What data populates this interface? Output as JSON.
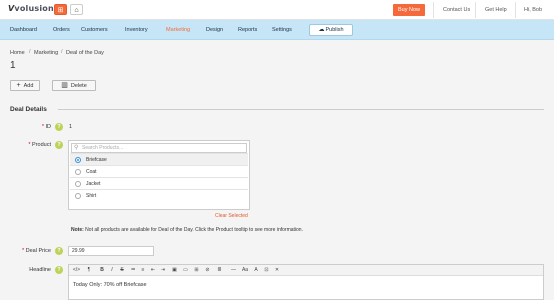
{
  "brand": {
    "logo_text": "volusion",
    "logo_mark": "V"
  },
  "topbar": {
    "store_icon": "store-icon",
    "home_icon": "home-icon",
    "buy_now": "Buy Now",
    "contact_us": "Contact Us",
    "get_help": "Get Help",
    "user": "Hi, Bob"
  },
  "nav": {
    "items": [
      "Dashboard",
      "Orders",
      "Customers",
      "Inventory",
      "Marketing",
      "Design",
      "Reports",
      "Settings"
    ],
    "active": "Marketing",
    "publish": "Publish"
  },
  "breadcrumb": [
    "Home",
    "Marketing",
    "Deal of the Day"
  ],
  "page_title": "1",
  "actions": {
    "add": "Add",
    "delete": "Delete"
  },
  "section": {
    "title": "Deal Details"
  },
  "fields": {
    "id_label": "ID",
    "id_value": "1",
    "product_label": "Product",
    "search_placeholder": "Search Products...",
    "products": [
      {
        "name": "Briefcase",
        "selected": true
      },
      {
        "name": "Coat",
        "selected": false
      },
      {
        "name": "Jacket",
        "selected": false
      },
      {
        "name": "Shirt",
        "selected": false
      }
    ],
    "clear_selected": "Clear Selected",
    "note_label": "Note:",
    "note_text": "Not all products are available for Deal of the Day. Click the Product tooltip to see more information.",
    "price_label": "Deal Price",
    "price_value": "29.99",
    "headline_label": "Headline",
    "headline_text": "Today Only: 70% off Briefcase"
  },
  "editor_toolbar": [
    "</>",
    "¶",
    "B",
    "I",
    "S",
    "≔",
    "≡",
    "⇤",
    "⇥",
    "▣",
    "▭",
    "⊞",
    "⊘",
    "≣",
    "—",
    "Aa",
    "A",
    "⊡",
    "✕"
  ],
  "colors": {
    "accent": "#f46a3a",
    "nav_bg": "#c6e6f7",
    "help": "#bcd35a",
    "link": "#e05a2a"
  }
}
